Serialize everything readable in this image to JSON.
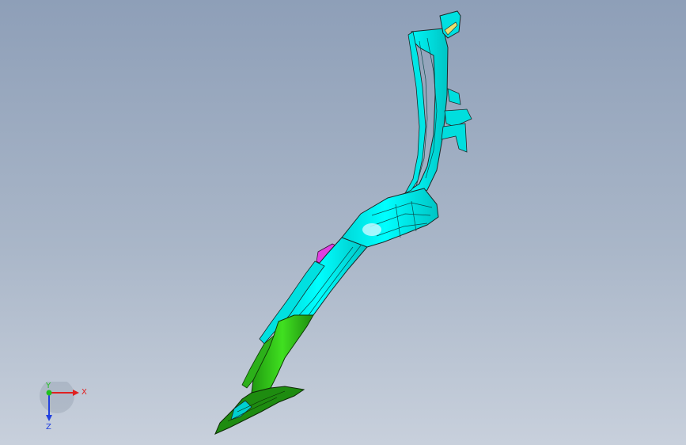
{
  "viewport": {
    "background_top": "#8e9fb8",
    "background_bottom": "#c8d0dc"
  },
  "model": {
    "colors": {
      "main_part": "#00ffff",
      "lower_part": "#33cc1a",
      "bracket": "#e040e0",
      "edges": "#1a2a2a",
      "tab": "#e8e070"
    }
  },
  "triad": {
    "x_label": "X",
    "y_label": "Y",
    "z_label": "Z",
    "x_color": "#e02020",
    "y_color": "#20c020",
    "z_color": "#2040e0"
  }
}
